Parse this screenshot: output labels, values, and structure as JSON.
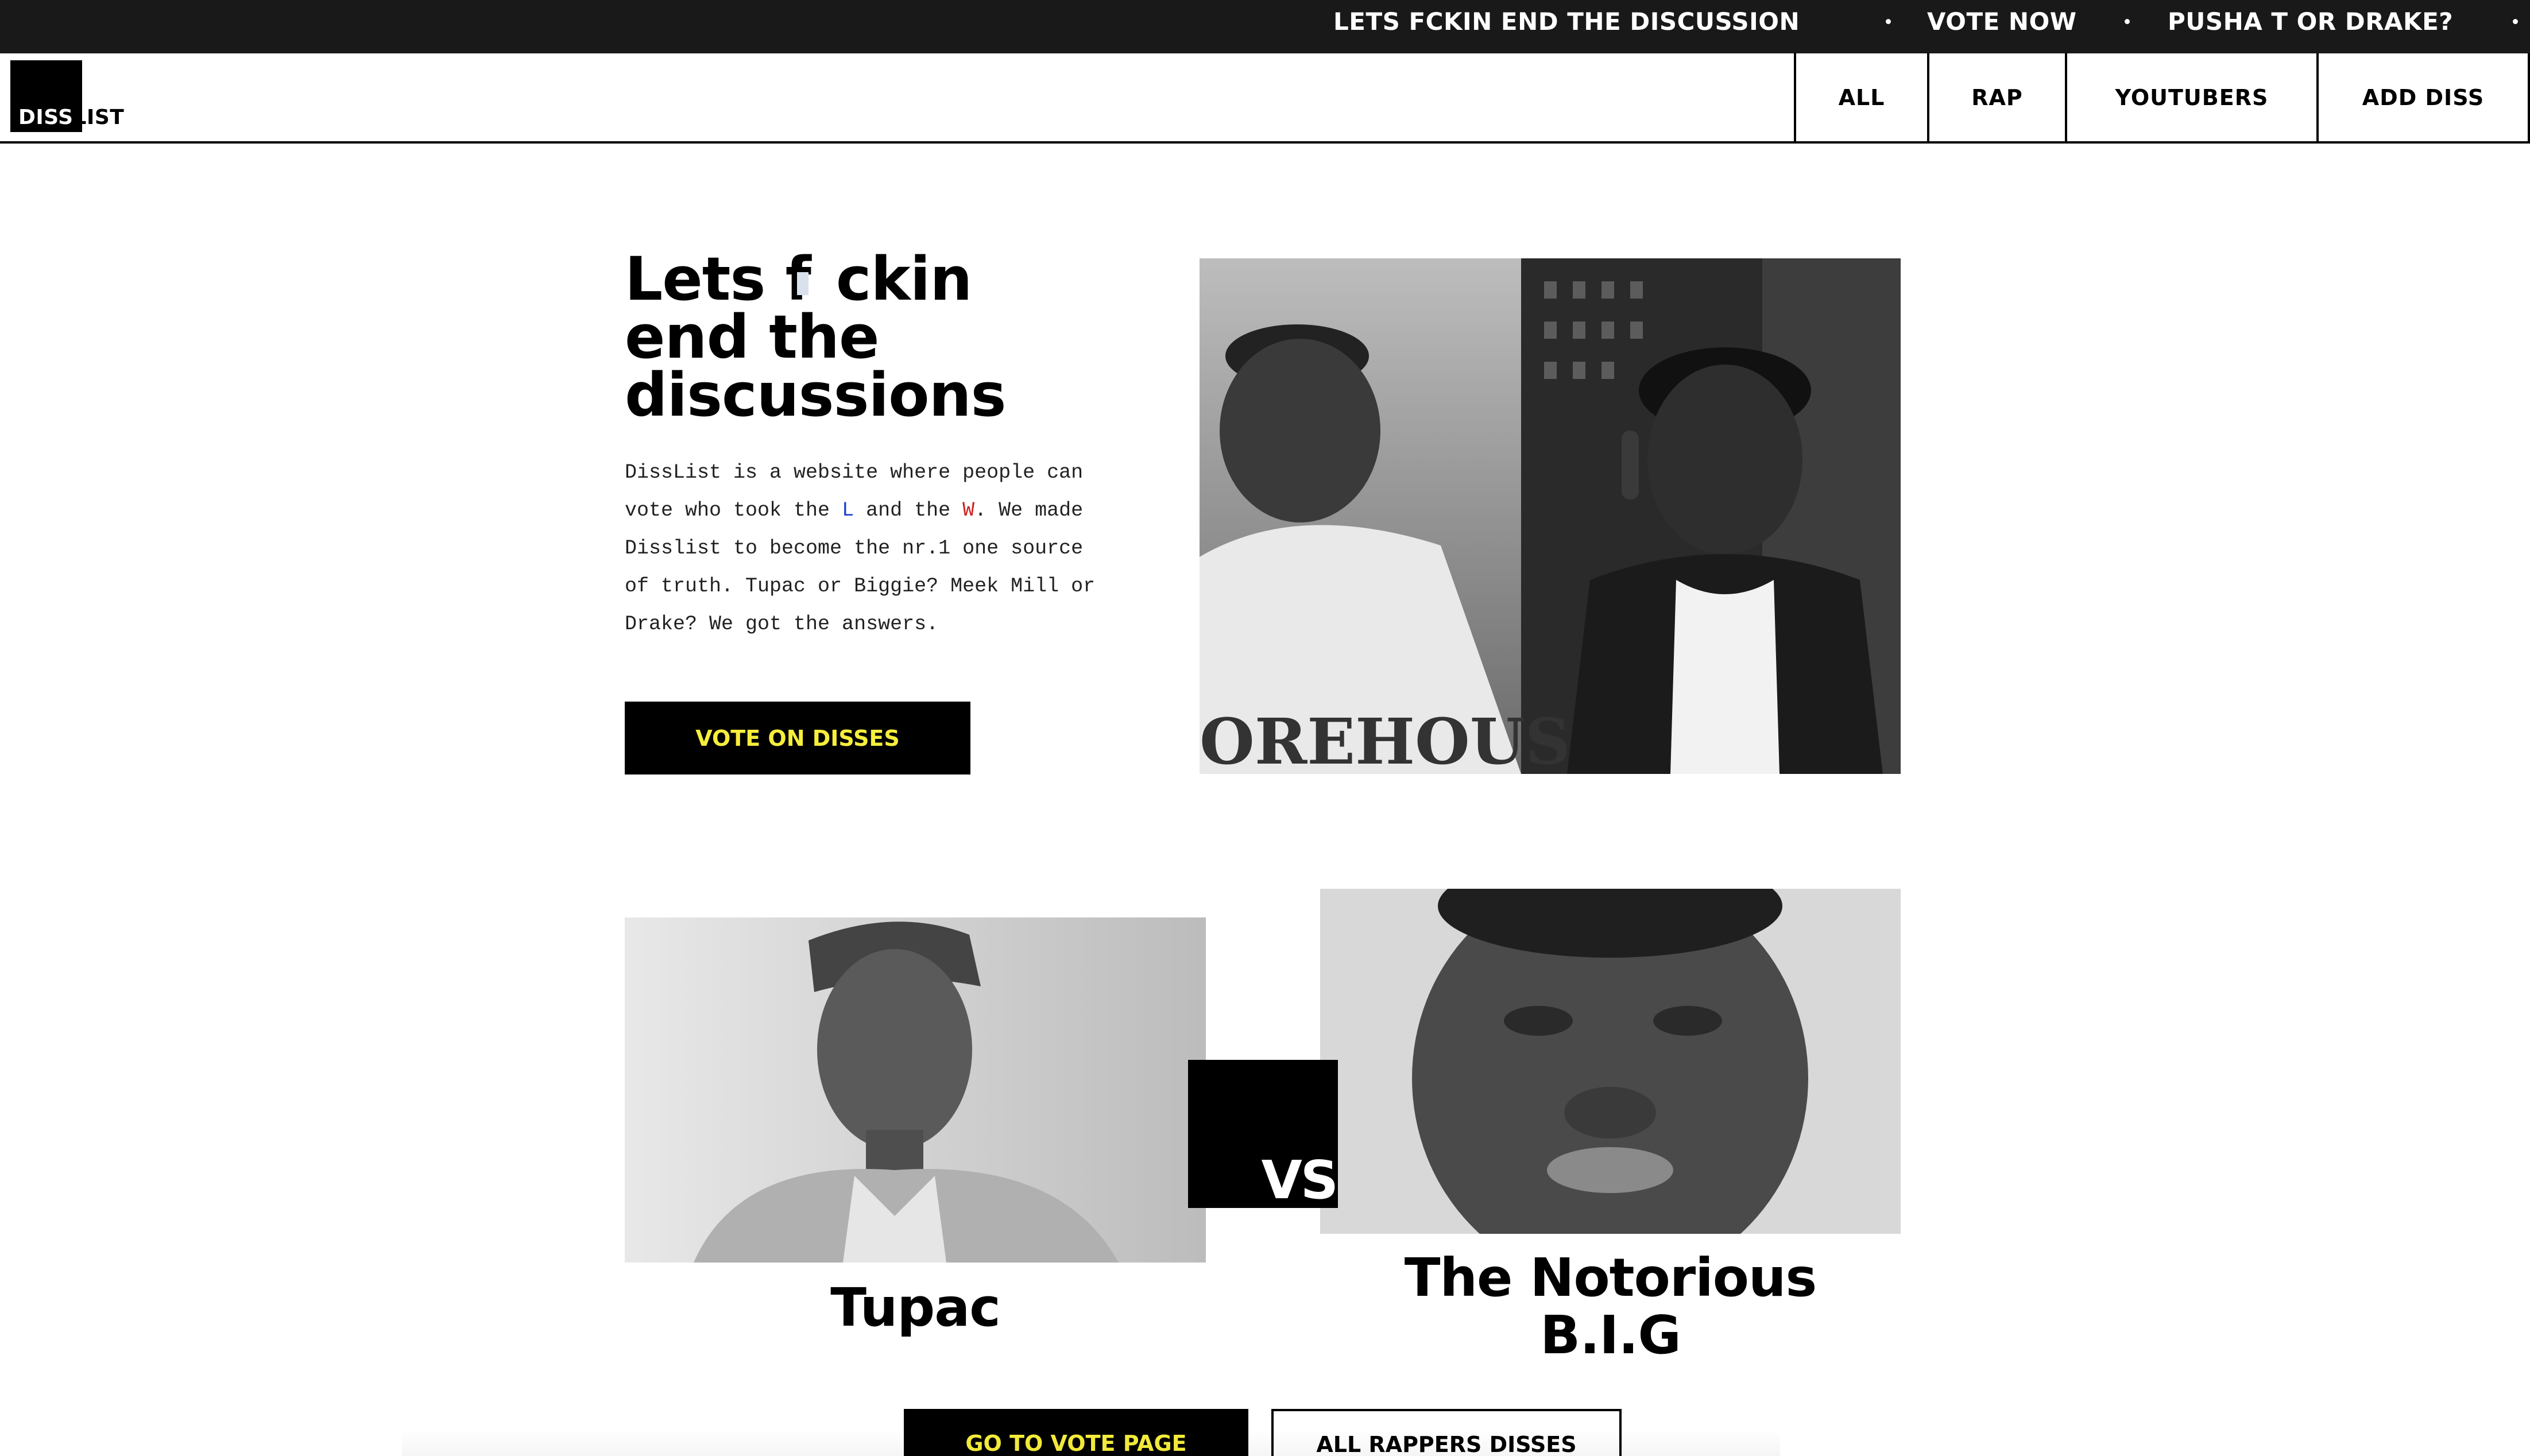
{
  "ticker": {
    "items": [
      "LETS FCKIN END THE DISCUSSION",
      "VOTE NOW",
      "PUSHA T OR DRAKE?"
    ]
  },
  "nav": {
    "logo_diss": "DISS",
    "logo_list": "LIST",
    "items": [
      "ALL",
      "RAP",
      "YOUTUBERS",
      "ADD DISS"
    ]
  },
  "hero": {
    "title_line1_a": "Lets f",
    "title_line1_b": "ckin",
    "title_line2": "end the",
    "title_line3": "discussions",
    "desc_1": "DissList is a website where people can vote who took the ",
    "desc_l": "L",
    "desc_2": " and the ",
    "desc_w": "W",
    "desc_3": ". We made Disslist to become the nr.1 one source of truth. Tupac or Biggie? Meek Mill or Drake? We got the answers.",
    "cta_label": "VOTE ON DISSES"
  },
  "versus": {
    "left_name": "Tupac",
    "vs_label": "VS",
    "right_name_line1": "The Notorious",
    "right_name_line2": "B.I.G",
    "vote_button": "GO TO VOTE PAGE",
    "all_button": "ALL RAPPERS DISSES"
  },
  "colors": {
    "ticker_bg": "#191919",
    "accent_yellow": "#f6ee3b",
    "l_blue": "#1a3fd0",
    "w_red": "#cc2020"
  }
}
